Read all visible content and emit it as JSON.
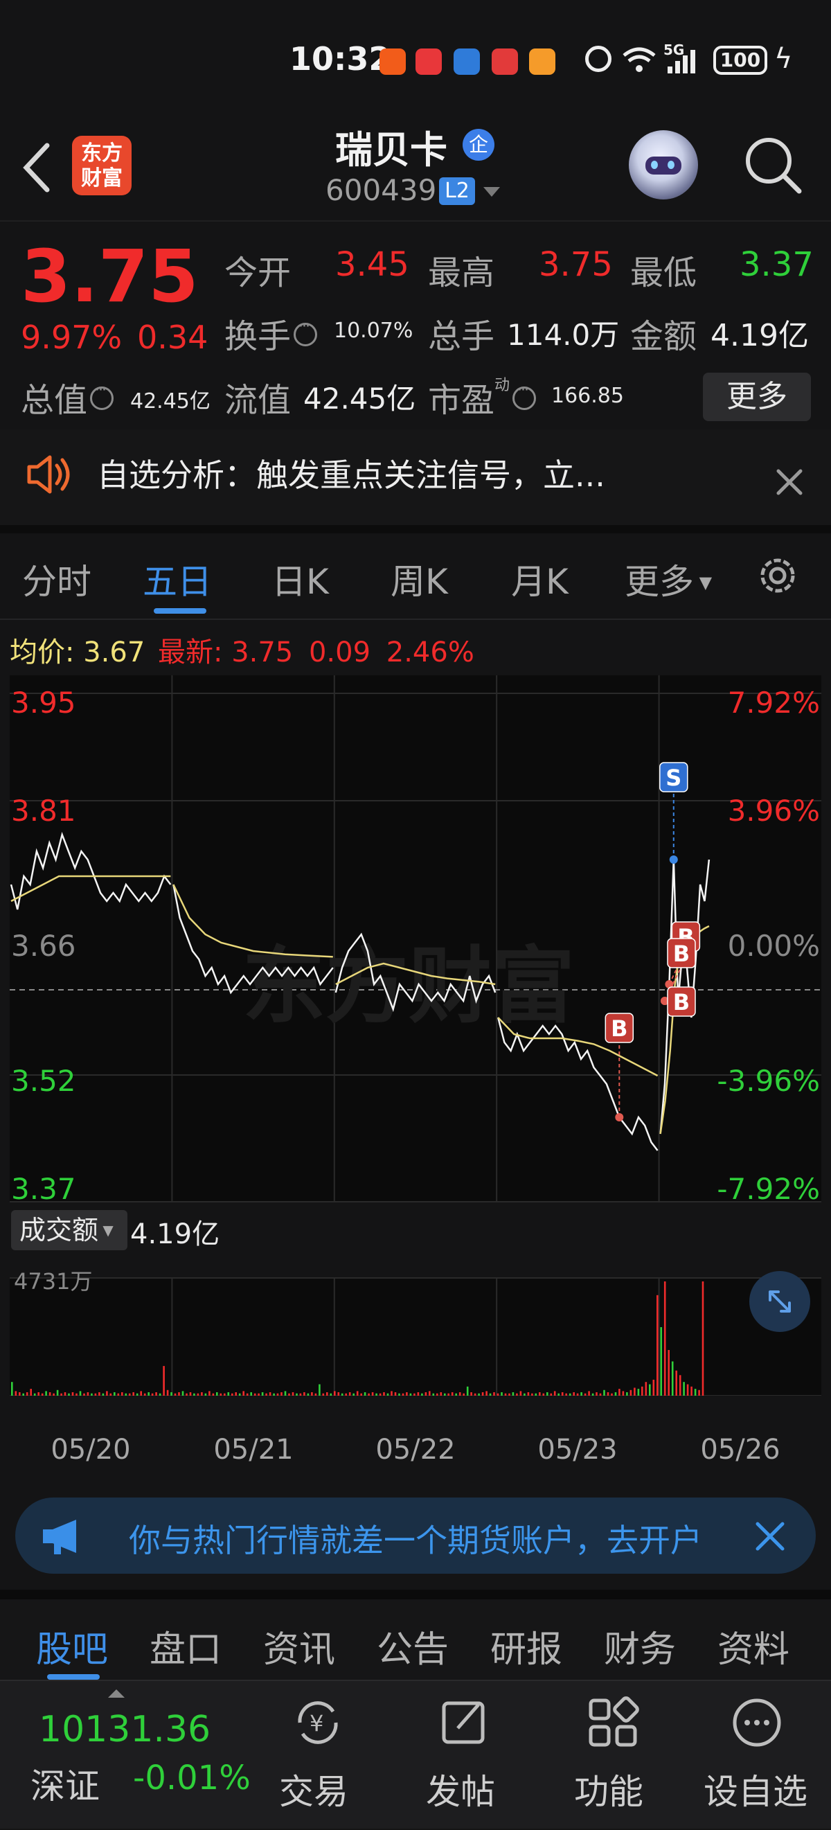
{
  "status_bar": {
    "time": "10:32",
    "network": "5G",
    "battery": "100"
  },
  "header": {
    "back_label": "‹",
    "logo_text_top": "东方",
    "logo_text_bottom": "财富",
    "stock_name": "瑞贝卡",
    "badge": "企",
    "stock_code": "600439",
    "level_badge": "L2"
  },
  "quote": {
    "price": "3.75",
    "change_pct": "9.97%",
    "change_abs": "0.34",
    "open_label": "今开",
    "open": "3.45",
    "high_label": "最高",
    "high": "3.75",
    "low_label": "最低",
    "low": "3.37",
    "turnover_label": "换手",
    "turnover": "10.07%",
    "volume_label": "总手",
    "volume": "114.0万",
    "amount_label": "金额",
    "amount": "4.19亿",
    "mktcap_label": "总值",
    "mktcap": "42.45亿",
    "float_label": "流值",
    "float": "42.45亿",
    "pe_label": "市盈",
    "pe_sup": "动",
    "pe": "166.85",
    "more_button": "更多"
  },
  "notice": {
    "text": "自选分析：触发重点关注信号，立..."
  },
  "tabs": [
    {
      "label": "分时"
    },
    {
      "label": "五日"
    },
    {
      "label": "日K"
    },
    {
      "label": "周K"
    },
    {
      "label": "月K"
    },
    {
      "label": "更多"
    }
  ],
  "chart_info": {
    "avg_label": "均价:",
    "avg": "3.67",
    "last_label": "最新:",
    "last": "3.75",
    "chg": "0.09",
    "chg_pct": "2.46%"
  },
  "chart_data": {
    "type": "line",
    "y_left_ticks": [
      "3.95",
      "3.81",
      "3.66",
      "3.52",
      "3.37"
    ],
    "y_right_ticks": [
      "7.92%",
      "3.96%",
      "0.00%",
      "-3.96%",
      "-7.92%"
    ],
    "ylim": [
      3.37,
      3.95
    ],
    "x_labels": [
      "05/20",
      "05/21",
      "05/22",
      "05/23",
      "05/26"
    ],
    "days": [
      {
        "date": "05/20",
        "prices": [
          3.72,
          3.69,
          3.73,
          3.72,
          3.76,
          3.74,
          3.77,
          3.75,
          3.78,
          3.76,
          3.74,
          3.76,
          3.75,
          3.73,
          3.71,
          3.7,
          3.71,
          3.7,
          3.72,
          3.71,
          3.7,
          3.71,
          3.7,
          3.71,
          3.73,
          3.72
        ],
        "avg": [
          3.7,
          3.71,
          3.72,
          3.73,
          3.73,
          3.73,
          3.73,
          3.73,
          3.73,
          3.73,
          3.73
        ]
      },
      {
        "date": "05/21",
        "prices": [
          3.72,
          3.68,
          3.66,
          3.64,
          3.63,
          3.61,
          3.62,
          3.6,
          3.61,
          3.59,
          3.6,
          3.61,
          3.6,
          3.61,
          3.62,
          3.61,
          3.62,
          3.61,
          3.62,
          3.61,
          3.62,
          3.61,
          3.62,
          3.6,
          3.61,
          3.62
        ],
        "avg": [
          3.72,
          3.68,
          3.66,
          3.65,
          3.645,
          3.64,
          3.638,
          3.636,
          3.635,
          3.634,
          3.633
        ]
      },
      {
        "date": "05/22",
        "prices": [
          3.59,
          3.62,
          3.64,
          3.65,
          3.66,
          3.64,
          3.6,
          3.61,
          3.59,
          3.57,
          3.6,
          3.59,
          3.58,
          3.6,
          3.59,
          3.58,
          3.59,
          3.58,
          3.6,
          3.59,
          3.58,
          3.61,
          3.58,
          3.6,
          3.61,
          3.59
        ],
        "avg": [
          3.6,
          3.61,
          3.62,
          3.625,
          3.62,
          3.615,
          3.61,
          3.607,
          3.605,
          3.603,
          3.6
        ]
      },
      {
        "date": "05/23",
        "prices": [
          3.56,
          3.53,
          3.52,
          3.54,
          3.52,
          3.53,
          3.54,
          3.55,
          3.54,
          3.55,
          3.54,
          3.52,
          3.53,
          3.51,
          3.52,
          3.5,
          3.49,
          3.48,
          3.46,
          3.44,
          3.43,
          3.42,
          3.44,
          3.43,
          3.41,
          3.4
        ],
        "avg": [
          3.56,
          3.54,
          3.535,
          3.535,
          3.535,
          3.532,
          3.528,
          3.52,
          3.51,
          3.5,
          3.49
        ]
      },
      {
        "date": "05/26",
        "prices": [
          3.42,
          3.48,
          3.6,
          3.75,
          3.58,
          3.64,
          3.62,
          3.56,
          3.63,
          3.72,
          3.7,
          3.75
        ],
        "avg": [
          3.42,
          3.46,
          3.52,
          3.6,
          3.64,
          3.65,
          3.655,
          3.66,
          3.663,
          3.667,
          3.67
        ]
      }
    ],
    "marks": [
      {
        "label": "S",
        "day": 4,
        "index": 3,
        "price": 3.75
      },
      {
        "label": "B",
        "day": 3,
        "index": 19,
        "price": 3.44
      },
      {
        "label": "B",
        "day": 4,
        "index": 2,
        "price": 3.6
      },
      {
        "label": "B",
        "day": 4,
        "index": 1,
        "price": 3.58
      },
      {
        "label": "B",
        "day": 4,
        "index": 1,
        "price": 3.58
      }
    ],
    "volume": {
      "label": "成交额",
      "total": "4.19亿",
      "max_label": "4731万",
      "values": [
        12,
        4,
        3,
        2,
        3,
        6,
        2,
        3,
        2,
        4,
        3,
        2,
        5,
        2,
        3,
        2,
        3,
        2,
        4,
        2,
        3,
        2,
        2,
        3,
        2,
        4,
        2,
        3,
        2,
        3,
        2,
        2,
        3,
        2,
        4,
        2,
        3,
        2,
        3,
        2,
        26,
        5,
        3,
        2,
        3,
        4,
        2,
        3,
        2,
        2,
        3,
        2,
        4,
        2,
        3,
        2,
        2,
        3,
        2,
        3,
        2,
        4,
        2,
        3,
        2,
        2,
        3,
        2,
        3,
        2,
        2,
        3,
        4,
        2,
        3,
        2,
        2,
        3,
        2,
        3,
        2,
        10,
        2,
        3,
        2,
        4,
        3,
        2,
        2,
        3,
        2,
        4,
        2,
        3,
        2,
        3,
        2,
        2,
        3,
        2,
        4,
        3,
        2,
        2,
        3,
        2,
        2,
        3,
        2,
        3,
        4,
        2,
        2,
        3,
        2,
        2,
        3,
        2,
        3,
        2,
        8,
        3,
        2,
        2,
        3,
        4,
        2,
        3,
        2,
        3,
        2,
        2,
        3,
        2,
        4,
        2,
        3,
        2,
        2,
        3,
        2,
        3,
        2,
        4,
        2,
        3,
        2,
        2,
        3,
        2,
        3,
        2,
        4,
        2,
        3,
        2,
        5,
        3,
        2,
        3,
        6,
        4,
        3,
        5,
        7,
        6,
        8,
        12,
        10,
        14,
        88,
        60,
        100,
        40,
        30,
        22,
        18,
        12,
        10,
        8,
        6,
        5,
        100
      ]
    }
  },
  "banner": {
    "text": "你与热门行情就差一个期货账户，去开户"
  },
  "bottom_tabs": [
    {
      "label": "股吧"
    },
    {
      "label": "盘口"
    },
    {
      "label": "资讯"
    },
    {
      "label": "公告"
    },
    {
      "label": "研报"
    },
    {
      "label": "财务"
    },
    {
      "label": "资料"
    }
  ],
  "nav": {
    "index_value": "10131.36",
    "index_name": "深证",
    "index_chg": "-0.01%",
    "items": [
      {
        "label": "交易"
      },
      {
        "label": "发帖"
      },
      {
        "label": "功能"
      },
      {
        "label": "设自选"
      }
    ]
  }
}
